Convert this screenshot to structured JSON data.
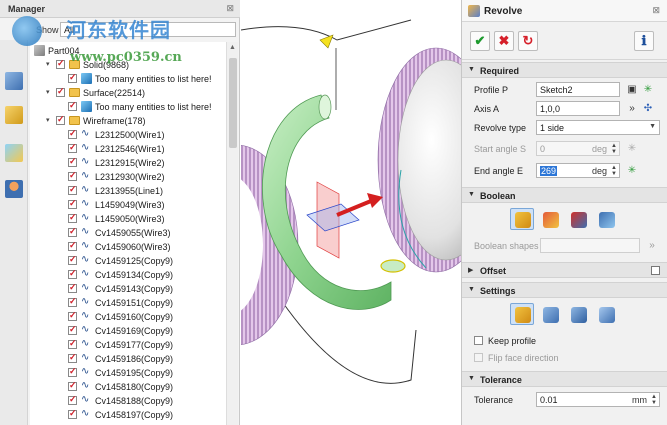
{
  "manager": {
    "title": "Manager",
    "close": "⊠",
    "show_label": "Show",
    "show_value": "All",
    "side_icons": [
      "shape-icon",
      "cube-icon",
      "image-icon",
      "user-icon"
    ],
    "tree": [
      {
        "label": "Part004",
        "level": 0,
        "kind": "part",
        "exp": ""
      },
      {
        "label": "Solid(9868)",
        "level": 1,
        "kind": "folder",
        "exp": "▾"
      },
      {
        "label": "Too many entities to list here!",
        "level": 2,
        "kind": "cube",
        "exp": ""
      },
      {
        "label": "Surface(22514)",
        "level": 1,
        "kind": "folder",
        "exp": "▾"
      },
      {
        "label": "Too many entities to list here!",
        "level": 2,
        "kind": "cube",
        "exp": ""
      },
      {
        "label": "Wireframe(178)",
        "level": 1,
        "kind": "folder",
        "exp": "▾"
      },
      {
        "label": "L2312500(Wire1)",
        "level": 2,
        "kind": "wire",
        "exp": ""
      },
      {
        "label": "L2312546(Wire1)",
        "level": 2,
        "kind": "wire",
        "exp": ""
      },
      {
        "label": "L2312915(Wire2)",
        "level": 2,
        "kind": "wire",
        "exp": ""
      },
      {
        "label": "L2312930(Wire2)",
        "level": 2,
        "kind": "wire",
        "exp": ""
      },
      {
        "label": "L2313955(Line1)",
        "level": 2,
        "kind": "wire",
        "exp": ""
      },
      {
        "label": "L1459049(Wire3)",
        "level": 2,
        "kind": "wire",
        "exp": ""
      },
      {
        "label": "L1459050(Wire3)",
        "level": 2,
        "kind": "wire",
        "exp": ""
      },
      {
        "label": "Cv1459055(Wire3)",
        "level": 2,
        "kind": "wire",
        "exp": ""
      },
      {
        "label": "Cv1459060(Wire3)",
        "level": 2,
        "kind": "wire",
        "exp": ""
      },
      {
        "label": "Cv1459125(Copy9)",
        "level": 2,
        "kind": "wire",
        "exp": ""
      },
      {
        "label": "Cv1459134(Copy9)",
        "level": 2,
        "kind": "wire",
        "exp": ""
      },
      {
        "label": "Cv1459143(Copy9)",
        "level": 2,
        "kind": "wire",
        "exp": ""
      },
      {
        "label": "Cv1459151(Copy9)",
        "level": 2,
        "kind": "wire",
        "exp": ""
      },
      {
        "label": "Cv1459160(Copy9)",
        "level": 2,
        "kind": "wire",
        "exp": ""
      },
      {
        "label": "Cv1459169(Copy9)",
        "level": 2,
        "kind": "wire",
        "exp": ""
      },
      {
        "label": "Cv1459177(Copy9)",
        "level": 2,
        "kind": "wire",
        "exp": ""
      },
      {
        "label": "Cv1459186(Copy9)",
        "level": 2,
        "kind": "wire",
        "exp": ""
      },
      {
        "label": "Cv1459195(Copy9)",
        "level": 2,
        "kind": "wire",
        "exp": ""
      },
      {
        "label": "Cv1458180(Copy9)",
        "level": 2,
        "kind": "wire",
        "exp": ""
      },
      {
        "label": "Cv1458188(Copy9)",
        "level": 2,
        "kind": "wire",
        "exp": ""
      },
      {
        "label": "Cv1458197(Copy9)",
        "level": 2,
        "kind": "wire",
        "exp": ""
      }
    ]
  },
  "watermark": {
    "title": "河东软件园",
    "url": "www.pc0359.cn"
  },
  "revolve": {
    "title": "Revolve",
    "close": "⊠",
    "toolbar": {
      "ok": "✔",
      "cancel": "✖",
      "apply": "↻",
      "info": "ℹ"
    },
    "sections": {
      "required": "Required",
      "boolean": "Boolean",
      "offset": "Offset",
      "settings": "Settings",
      "tolerance": "Tolerance"
    },
    "fields": {
      "profile_label": "Profile P",
      "profile_value": "Sketch2",
      "axis_label": "Axis A",
      "axis_value": "1,0,0",
      "type_label": "Revolve type",
      "type_value": "1 side",
      "start_label": "Start angle S",
      "start_value": "0",
      "start_unit": "deg",
      "end_label": "End angle E",
      "end_value": "269",
      "end_unit": "deg",
      "bool_shapes_label": "Boolean shapes",
      "tolerance_label": "Tolerance",
      "tolerance_value": "0.01",
      "tolerance_unit": "mm"
    },
    "checks": {
      "keep_profile": "Keep profile",
      "flip_face": "Flip face direction"
    },
    "colors": {
      "ok": "#1e9a2e",
      "cancel": "#d6202a",
      "accent": "#2c76d7"
    }
  }
}
